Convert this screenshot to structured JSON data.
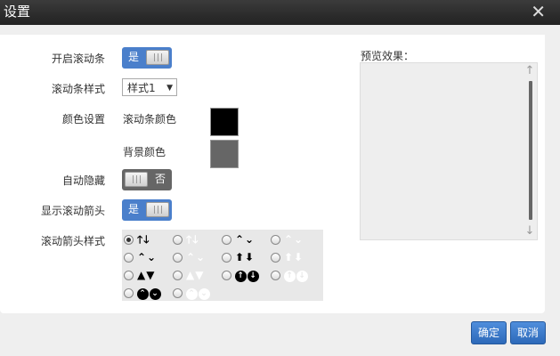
{
  "dialog": {
    "title": "设置",
    "close": "✕"
  },
  "form": {
    "enable_scrollbar": {
      "label": "开启滚动条",
      "value": "是",
      "state": "on"
    },
    "scrollbar_style": {
      "label": "滚动条样式",
      "selected": "样式1"
    },
    "color_settings": {
      "label": "颜色设置",
      "scrollbar_color_label": "滚动条颜色",
      "scrollbar_color": "#000000",
      "background_color_label": "背景颜色",
      "background_color": "#666666"
    },
    "auto_hide": {
      "label": "自动隐藏",
      "value": "否",
      "state": "off"
    },
    "show_arrows": {
      "label": "显示滚动箭头",
      "value": "是",
      "state": "on"
    },
    "arrow_style": {
      "label": "滚动箭头样式",
      "selected_index": 0,
      "options": [
        {
          "up": "🡑",
          "down": "🡓",
          "variant": "dark"
        },
        {
          "up": "🡑",
          "down": "🡓",
          "variant": "light"
        },
        {
          "up": "⌃",
          "down": "⌄",
          "variant": "dark"
        },
        {
          "up": "⌃",
          "down": "⌄",
          "variant": "light"
        },
        {
          "up": "⌃",
          "down": "⌄",
          "variant": "dark"
        },
        {
          "up": "⌃",
          "down": "⌄",
          "variant": "light"
        },
        {
          "up": "⬆",
          "down": "⬇",
          "variant": "dark"
        },
        {
          "up": "⬆",
          "down": "⬇",
          "variant": "light"
        },
        {
          "up": "▲",
          "down": "▼",
          "variant": "dark"
        },
        {
          "up": "▲",
          "down": "▼",
          "variant": "light"
        },
        {
          "up": "↑",
          "down": "↓",
          "variant": "dark-circle"
        },
        {
          "up": "↑",
          "down": "↓",
          "variant": "light-circle"
        },
        {
          "up": "⌃",
          "down": "⌄",
          "variant": "dark-circle"
        },
        {
          "up": "⌃",
          "down": "⌄",
          "variant": "light-circle"
        }
      ]
    }
  },
  "preview": {
    "label": "预览效果：",
    "arrow_up": "↑",
    "arrow_down": "↓"
  },
  "buttons": {
    "confirm": "确定",
    "cancel": "取消"
  },
  "colors": {
    "accent": "#4a7fcb",
    "titlebar": "#2b2b2b"
  }
}
